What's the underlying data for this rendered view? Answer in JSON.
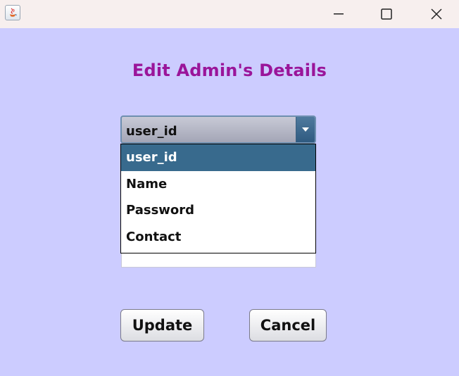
{
  "window": {
    "icons": {
      "app": "java-app-icon",
      "minimize": "minimize-icon",
      "maximize": "maximize-icon",
      "close": "close-icon"
    }
  },
  "form": {
    "title": "Edit Admin's Details",
    "field_select": {
      "selected": "user_id",
      "options": [
        "user_id",
        "Name",
        "Password",
        "Contact"
      ],
      "highlighted_index": 0
    },
    "value_input": {
      "value": ""
    },
    "buttons": {
      "update": "Update",
      "cancel": "Cancel"
    }
  },
  "colors": {
    "background": "#ccccff",
    "title": "#9a159a",
    "selection": "#386a8d"
  }
}
